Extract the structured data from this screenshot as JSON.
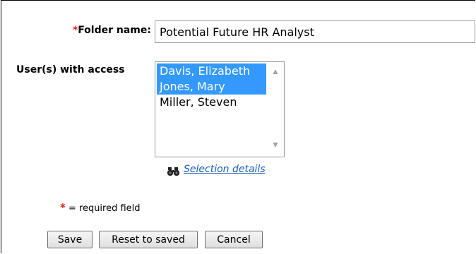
{
  "form": {
    "folder_label": "Folder name:",
    "required_marker": "*",
    "folder_value": "Potential Future HR Analyst",
    "users_label": "User(s) with access",
    "users": [
      {
        "name": "Davis, Elizabeth",
        "selected": true
      },
      {
        "name": "Jones, Mary",
        "selected": true
      },
      {
        "name": "Miller, Steven",
        "selected": false
      }
    ],
    "selection_details_label": "Selection details",
    "required_note_marker": "*",
    "required_note_text": "= required field"
  },
  "buttons": {
    "save_label": "Save",
    "reset_label": "Reset to saved",
    "cancel_label": "Cancel"
  },
  "colors": {
    "required_marker": "#e0201b",
    "selection_highlight": "#3399ff",
    "link": "#1a5fb4"
  },
  "icons": {
    "selection_details": "binoculars-icon",
    "scroll_up": "scroll-up-arrow-icon",
    "scroll_down": "scroll-down-arrow-icon"
  }
}
